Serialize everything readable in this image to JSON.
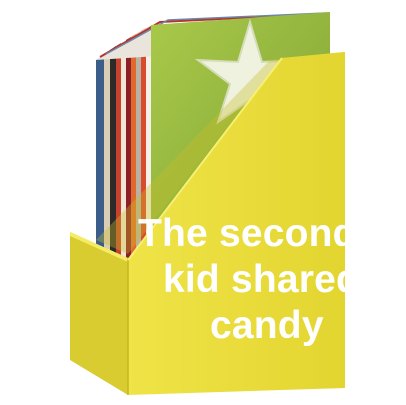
{
  "image": {
    "subject": "yellow magazine file box holding a stack of colorful magazines",
    "background_color": "#ffffff",
    "box_color": "#e8dc3c",
    "box_shadow_color": "#c9bd24",
    "caption_color": "#ffffff"
  },
  "caption": {
    "line_1": "The second",
    "line_2": "kid shared",
    "line_3": "candy"
  }
}
